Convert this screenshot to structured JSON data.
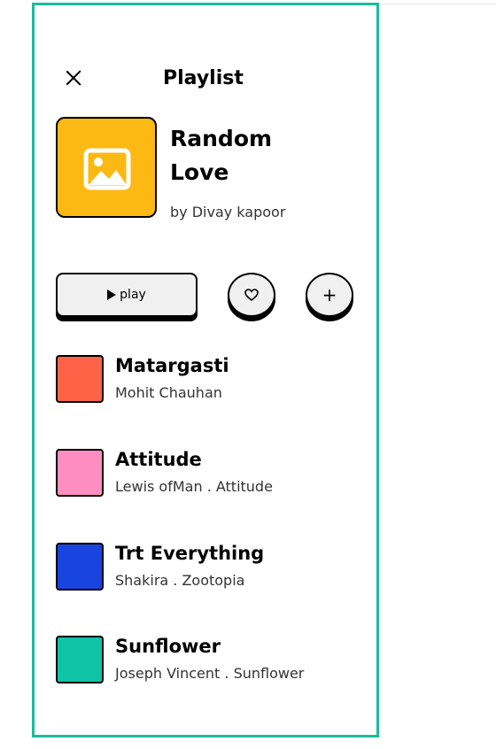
{
  "header": {
    "title": "Playlist",
    "close_icon": "close-icon"
  },
  "album": {
    "title": "Random Love",
    "by": "by Divay kapoor",
    "cover_color": "#fdb913",
    "cover_icon": "image-placeholder-icon"
  },
  "actions": {
    "play_label": "play",
    "like_icon": "heart-icon",
    "add_label": "+"
  },
  "tracks": [
    {
      "title": "Matargasti",
      "subtitle": "Mohit Chauhan",
      "color": "#ff6347"
    },
    {
      "title": "Attitude",
      "subtitle": "Lewis ofMan . Attitude",
      "color": "#ff8ec0"
    },
    {
      "title": "Trt Everything",
      "subtitle": "Shakira . Zootopia",
      "color": "#1a44e0"
    },
    {
      "title": "Sunflower",
      "subtitle": "Joseph Vincent . Sunflower",
      "color": "#0fc3a6"
    }
  ],
  "colors": {
    "frame_border": "#1abc9c",
    "button_bg": "#f0f0f0"
  }
}
